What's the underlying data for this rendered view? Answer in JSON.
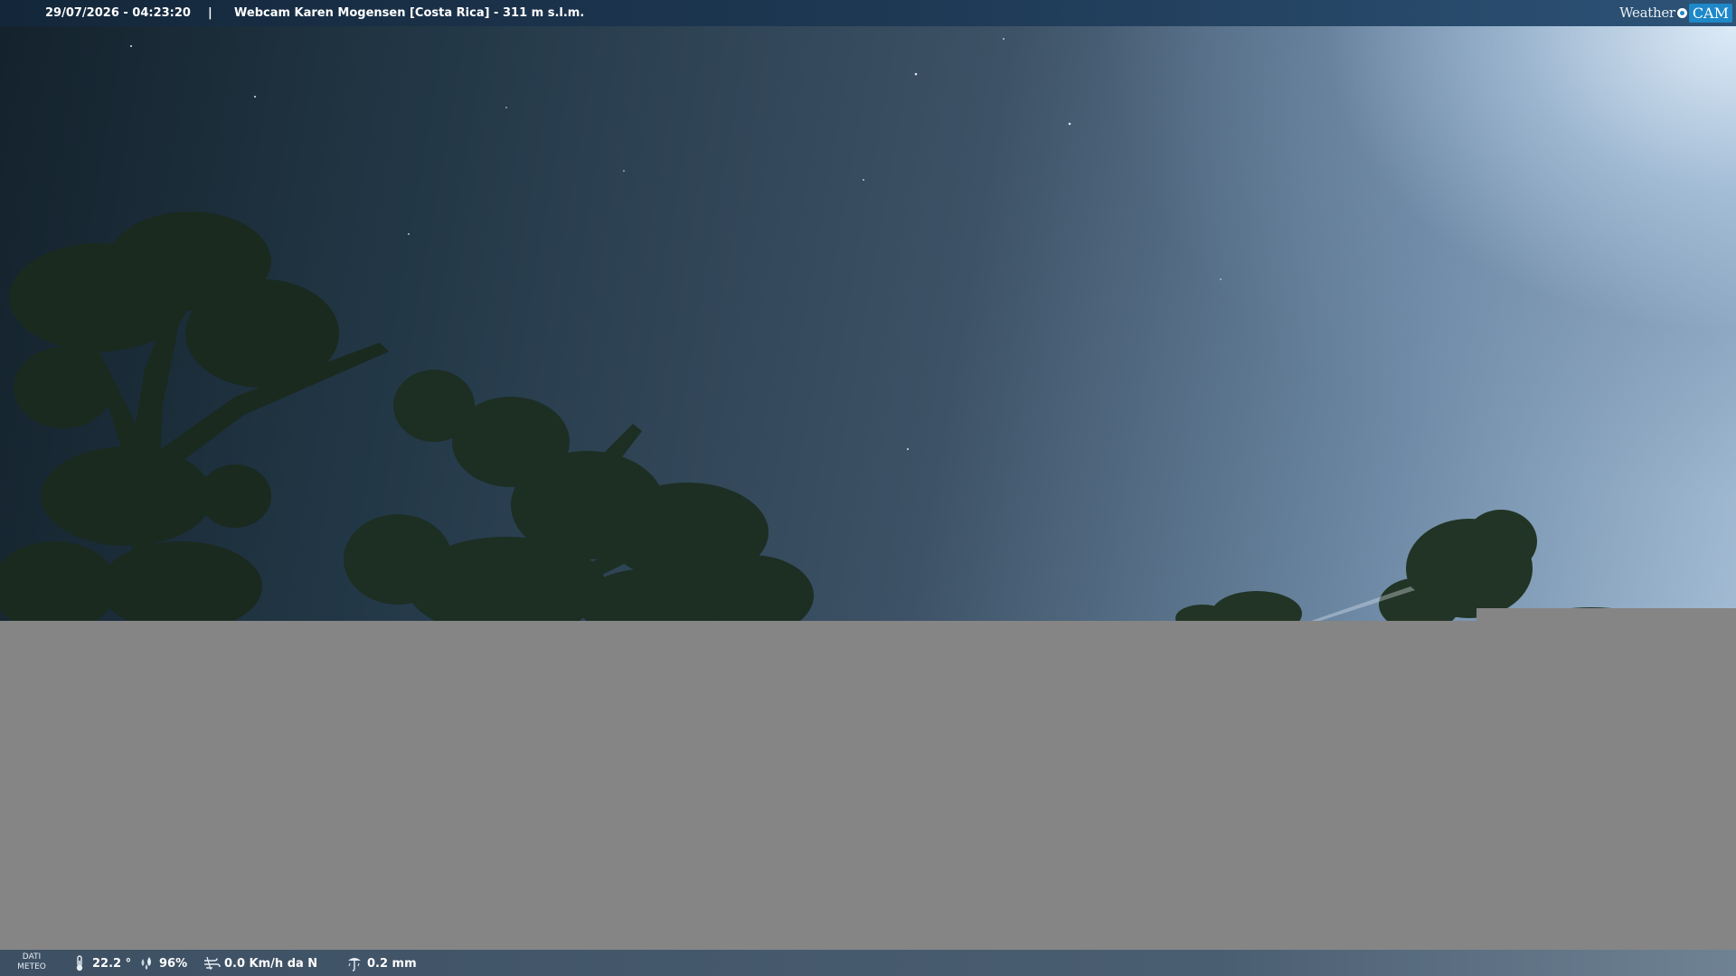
{
  "header": {
    "datetime": "29/07/2026 - 04:23:20",
    "separator": "|",
    "title": "Webcam Karen Mogensen [Costa Rica]  - 311 m s.l.m."
  },
  "logo": {
    "part1": "Weather",
    "part2": "CAM"
  },
  "footer": {
    "dati_label_line1": "DATI",
    "dati_label_line2": "METEO",
    "temperature": "22.2 °",
    "humidity": "96%",
    "wind": "0.0 Km/h da N",
    "rain": "0.2 mm"
  },
  "icons": {
    "temperature": "thermometer-icon",
    "humidity": "droplets-icon",
    "wind": "wind-icon",
    "rain": "rain-gauge-icon"
  },
  "colors": {
    "logo_accent": "#1e88c8",
    "header_bar": "#1f3a56",
    "footer_bar": "#4a5e72",
    "no_signal_area": "#858585"
  }
}
